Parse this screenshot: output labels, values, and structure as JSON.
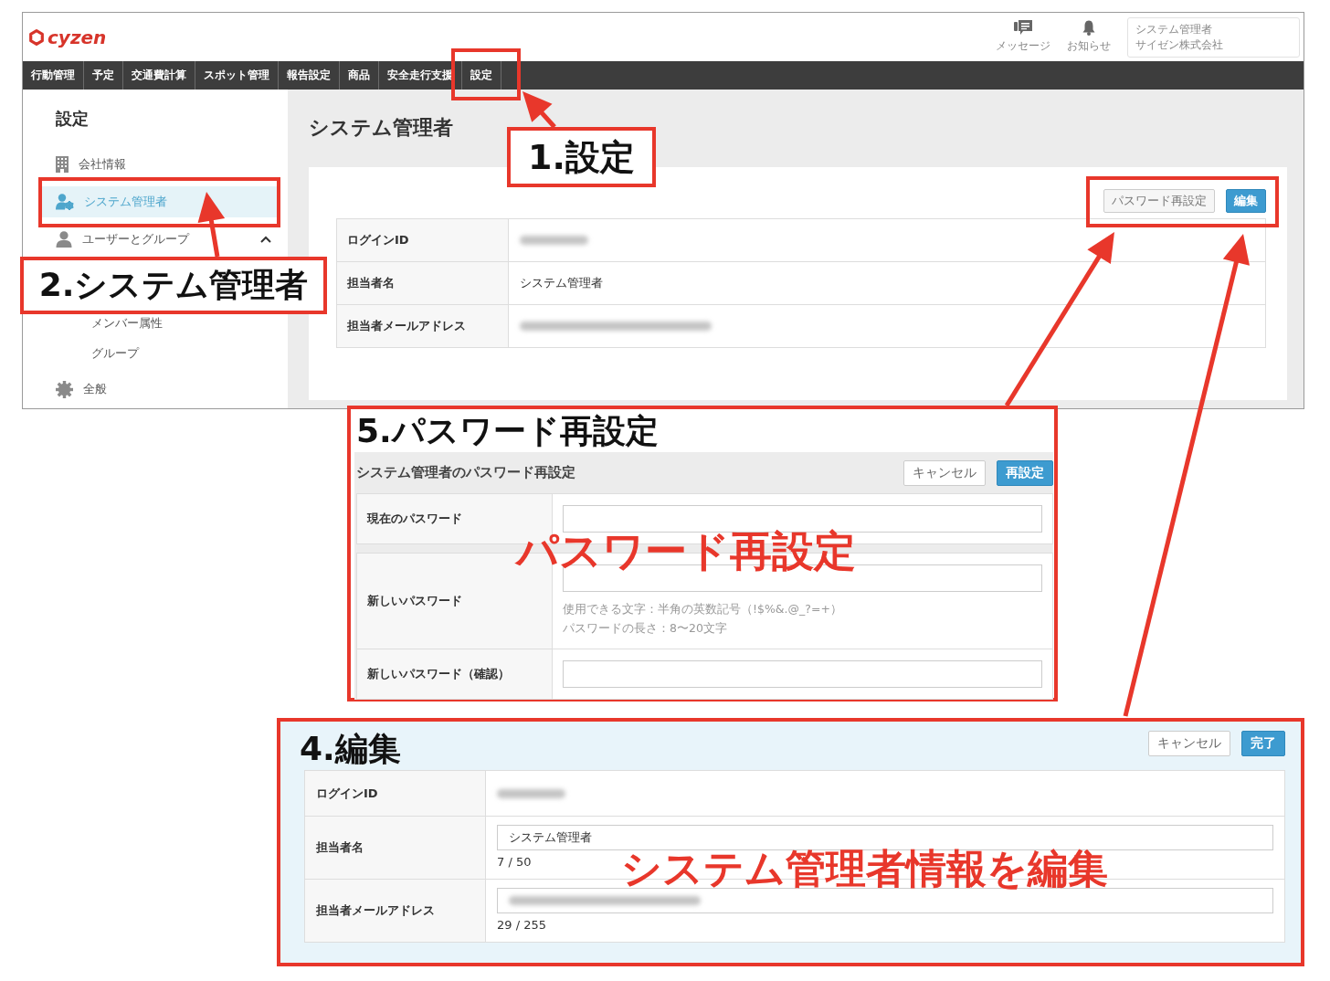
{
  "app": {
    "header": {
      "logo": "cyzen",
      "actions": [
        {
          "label": "メッセージ"
        },
        {
          "label": "お知らせ"
        }
      ],
      "account": {
        "name": "システム管理者",
        "company": "サイゼン株式会社"
      }
    },
    "nav_tabs": [
      {
        "label": "行動管理"
      },
      {
        "label": "予定"
      },
      {
        "label": "交通費計算"
      },
      {
        "label": "スポット管理"
      },
      {
        "label": "報告設定"
      },
      {
        "label": "商品"
      },
      {
        "label": "安全走行支援"
      },
      {
        "label": "設定"
      }
    ],
    "sidebar": {
      "title": "設定",
      "items": [
        {
          "label": "会社情報",
          "selected": false
        },
        {
          "label": "システム管理者",
          "selected": true
        },
        {
          "label": "ユーザーとグループ",
          "selected": false,
          "expanded": true,
          "children": [
            {
              "label": "メンバー属性",
              "selected": false
            },
            {
              "label": "グループ",
              "selected": false
            }
          ]
        },
        {
          "label": "全般",
          "selected": false
        }
      ]
    },
    "main": {
      "title": "システム管理者",
      "buttons": [
        {
          "label": "パスワード再設定",
          "kind": "default"
        },
        {
          "label": "編集",
          "kind": "primary"
        }
      ],
      "rows": [
        {
          "label": "ログインID",
          "kind": "blurred"
        },
        {
          "label": "担当者名",
          "kind": "text",
          "value": "システム管理者"
        },
        {
          "label": "担当者メールアドレス",
          "kind": "blurred"
        }
      ]
    }
  },
  "callouts": [
    {
      "label": "1.設定"
    },
    {
      "label": "2.システム管理者"
    }
  ],
  "password_panel": {
    "caption": "5.パスワード再設定",
    "title": "システム管理者のパスワード再設定",
    "buttons": [
      {
        "label": "キャンセル",
        "kind": "default"
      },
      {
        "label": "再設定",
        "kind": "primary"
      }
    ],
    "fields": [
      {
        "label": "現在のパスワード"
      },
      {
        "label": "新しいパスワード",
        "hints": [
          "使用できる文字：半角の英数記号（!$%&.@_?=+）",
          "パスワードの長さ：8〜20文字"
        ]
      },
      {
        "label": "新しいパスワード（確認）"
      }
    ],
    "overlay": "パスワード再設定"
  },
  "edit_panel": {
    "caption": "4.編集",
    "buttons": [
      {
        "label": "キャンセル",
        "kind": "default"
      },
      {
        "label": "完了",
        "kind": "primary"
      }
    ],
    "rows": [
      {
        "label": "ログインID",
        "kind": "blurred"
      },
      {
        "label": "担当者名",
        "kind": "input",
        "value": "システム管理者",
        "counter": "7 / 50"
      },
      {
        "label": "担当者メールアドレス",
        "kind": "blurred_input",
        "counter": "29 / 255"
      }
    ],
    "overlay": "システム管理者情報を編集"
  }
}
